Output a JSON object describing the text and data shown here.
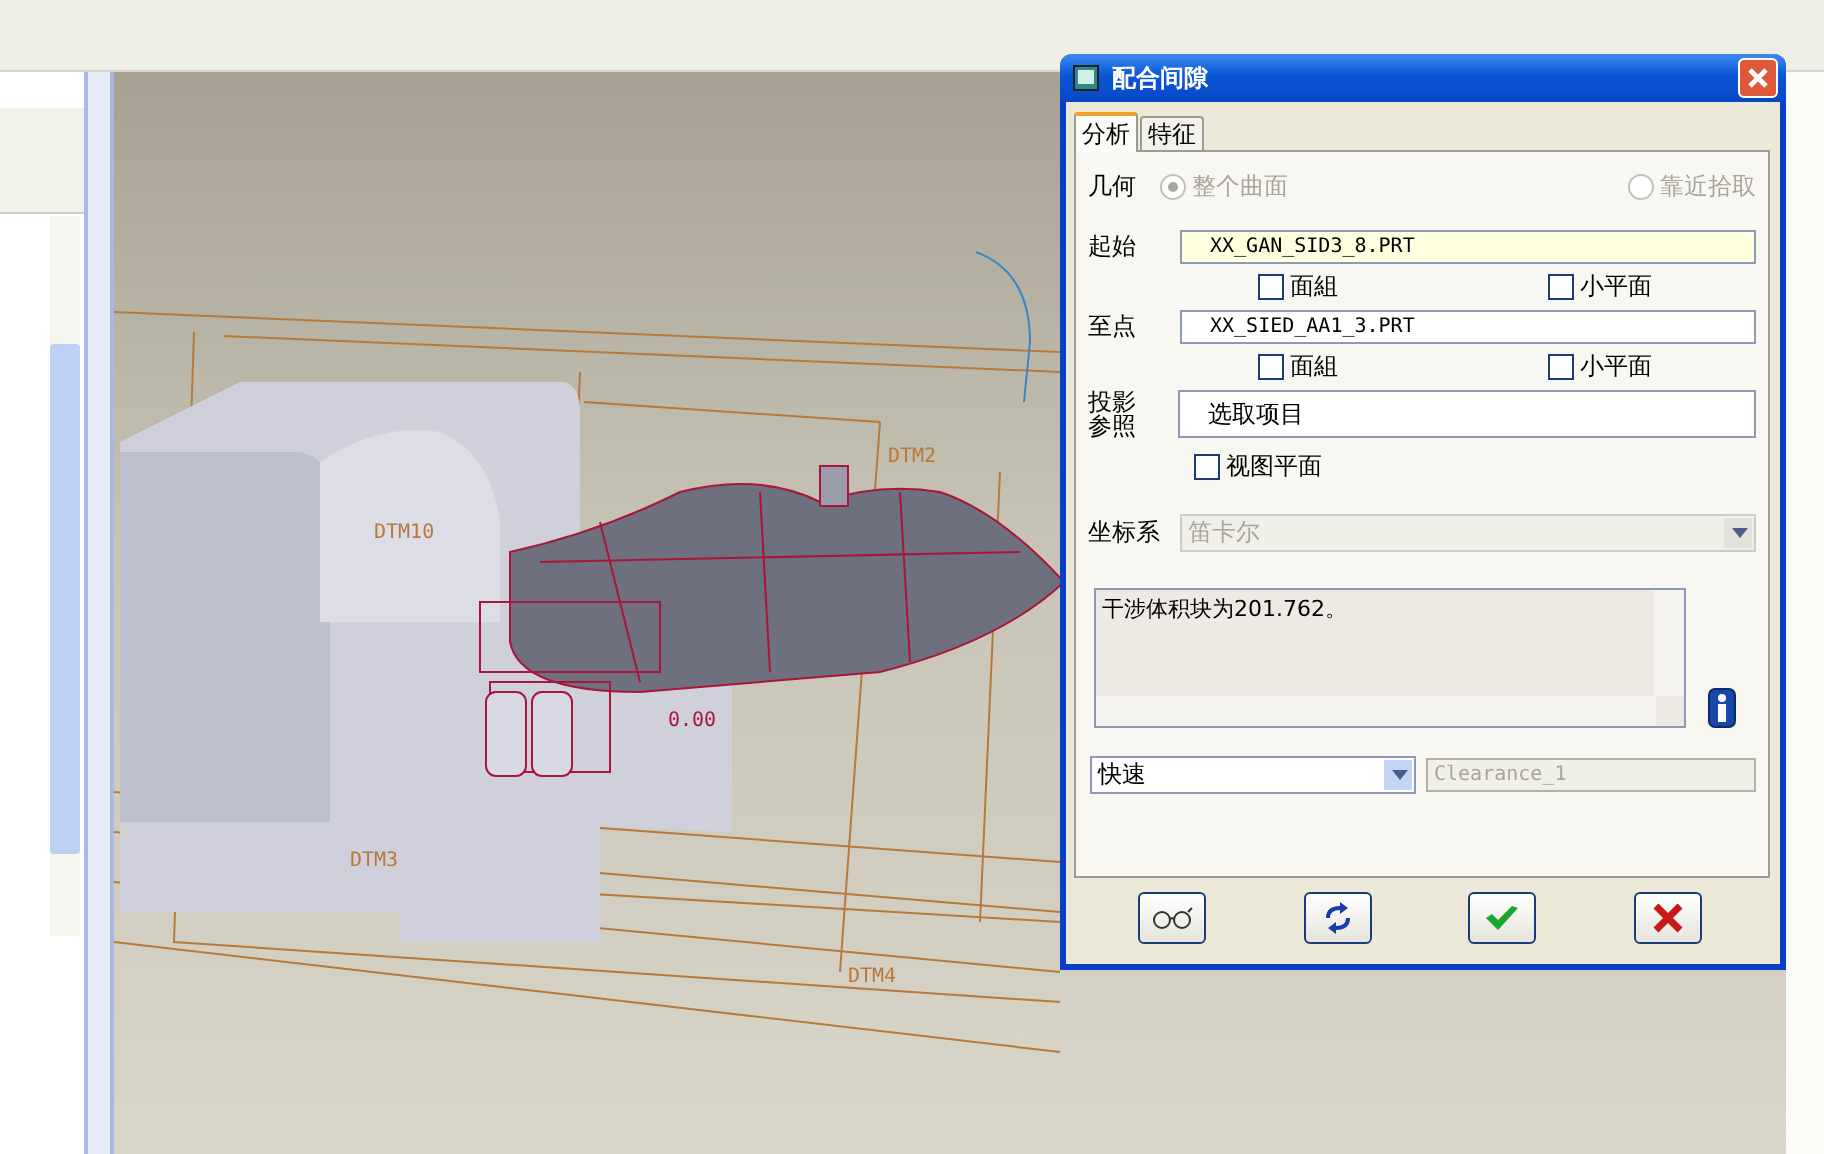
{
  "window": {
    "title": "配合间隙"
  },
  "tabs": [
    {
      "label": "分析",
      "selected": true
    },
    {
      "label": "特征",
      "selected": false
    }
  ],
  "geometry": {
    "label": "几何",
    "disabled": true,
    "options": [
      {
        "label": "整个曲面",
        "selected": true
      },
      {
        "label": "靠近拾取",
        "selected": false
      }
    ]
  },
  "from": {
    "label": "起始",
    "value": "XX_GAN_SID3_8.PRT",
    "active": true,
    "checkboxes": [
      {
        "label": "面組",
        "checked": false
      },
      {
        "label": "小平面",
        "checked": false
      }
    ]
  },
  "to": {
    "label": "至点",
    "value": "XX_SIED_AA1_3.PRT",
    "active": false,
    "checkboxes": [
      {
        "label": "面組",
        "checked": false
      },
      {
        "label": "小平面",
        "checked": false
      }
    ]
  },
  "projection": {
    "label": "投影参照",
    "value": "选取项目",
    "checkbox": {
      "label": "视图平面",
      "checked": false
    }
  },
  "coordinate_system": {
    "label": "坐标系",
    "value": "笛卡尔",
    "disabled": true
  },
  "result": {
    "text": "干涉体积块为201.762。"
  },
  "mode": {
    "value": "快速"
  },
  "name_field": {
    "value": "Clearance_1",
    "disabled": true
  },
  "buttons": [
    {
      "kind": "preview"
    },
    {
      "kind": "repeat"
    },
    {
      "kind": "ok"
    },
    {
      "kind": "cancel"
    }
  ],
  "viewport": {
    "datum_labels": [
      "DTM10",
      "DTM2",
      "DTM3",
      "DTM4"
    ],
    "dimension": "0.00"
  }
}
